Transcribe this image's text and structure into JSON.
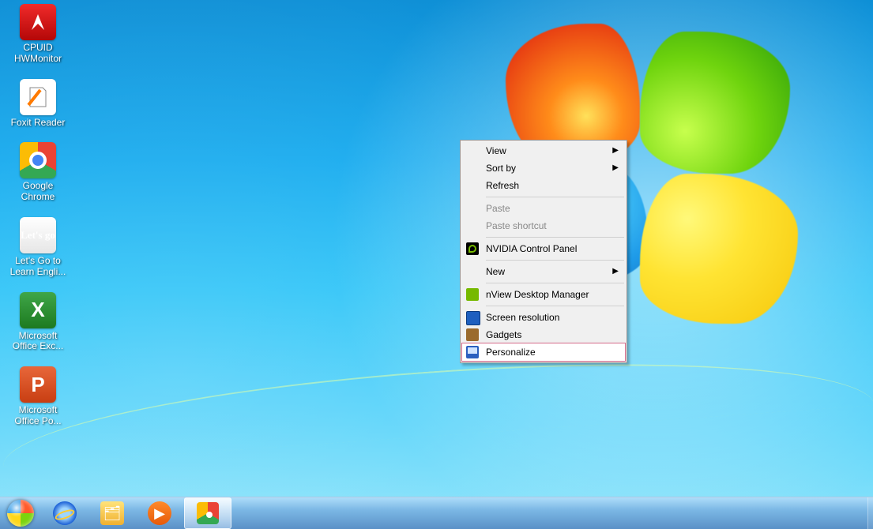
{
  "desktop_icons": [
    {
      "label": "CPUID HWMonitor",
      "icon": "hwmonitor"
    },
    {
      "label": "Foxit Reader",
      "icon": "foxit"
    },
    {
      "label": "Google Chrome",
      "icon": "chrome"
    },
    {
      "label": "Let's Go to Learn Engli...",
      "icon": "letsgo"
    },
    {
      "label": "Microsoft Office Exc...",
      "icon": "excel"
    },
    {
      "label": "Microsoft Office Po...",
      "icon": "ppt"
    }
  ],
  "context_menu": {
    "view": {
      "label": "View",
      "submenu": true
    },
    "sortby": {
      "label": "Sort by",
      "submenu": true
    },
    "refresh": {
      "label": "Refresh"
    },
    "paste": {
      "label": "Paste",
      "disabled": true
    },
    "pastesc": {
      "label": "Paste shortcut",
      "disabled": true
    },
    "nvidia": {
      "label": "NVIDIA Control Panel",
      "icon": "nvidia"
    },
    "new": {
      "label": "New",
      "submenu": true
    },
    "nview": {
      "label": "nView Desktop Manager",
      "icon": "nview"
    },
    "screenres": {
      "label": "Screen resolution",
      "icon": "screen"
    },
    "gadgets": {
      "label": "Gadgets",
      "icon": "gadget"
    },
    "personalize": {
      "label": "Personalize",
      "icon": "personalize",
      "highlighted": true
    }
  },
  "taskbar": {
    "start": "Start",
    "ie": "Internet Explorer",
    "explorer": "Windows Explorer",
    "media": "Windows Media Player",
    "chrome": "Google Chrome"
  }
}
